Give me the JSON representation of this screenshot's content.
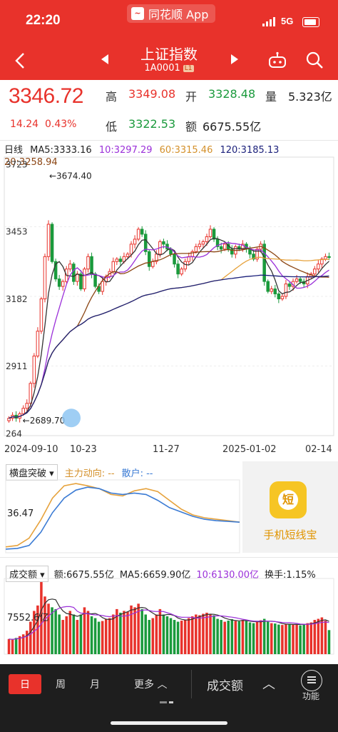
{
  "status": {
    "time": "22:20",
    "app_name": "同花顺 App",
    "network": "5G"
  },
  "header": {
    "title": "上证指数",
    "code": "1A0001",
    "level_tag": "L1"
  },
  "quote": {
    "price": "3346.72",
    "change": "14.24",
    "change_pct": "0.43%",
    "high_label": "高",
    "high": "3349.08",
    "open_label": "开",
    "open": "3328.48",
    "vol_label": "量",
    "volume": "5.323亿",
    "low_label": "低",
    "low": "3322.53",
    "amount_label": "额",
    "amount": "6675.55亿"
  },
  "ma": {
    "period": "日线",
    "ma5": "MA5:3333.16",
    "ma10": "10:3297.29",
    "ma60": "60:3315.46",
    "ma120": "120:3185.13",
    "ma20": "20:3258.94"
  },
  "colors": {
    "brand": "#e8322b",
    "up": "#e8322b",
    "down": "#1a9a3c",
    "ma5": "#333333",
    "ma10": "#9b30d9",
    "ma20": "#8b4513",
    "ma60": "#e6a23c",
    "ma120": "#1a1f7a"
  },
  "chart_data": [
    {
      "type": "candlestick",
      "ylim": [
        2630,
        3750
      ],
      "y_ticks": [
        "3723",
        "3453",
        "3182",
        "2911",
        "264"
      ],
      "x_ticks": [
        "2024-09-10",
        "10-23",
        "11-27",
        "2025-01-02",
        "02-14"
      ],
      "annotations": [
        "←3674.40",
        "←2689.70"
      ],
      "close": [
        2700,
        2712,
        2700,
        2718,
        2740,
        2760,
        2840,
        2950,
        3050,
        3180,
        3350,
        3480,
        3330,
        3260,
        3230,
        3250,
        3300,
        3320,
        3250,
        3280,
        3220,
        3300,
        3350,
        3280,
        3230,
        3210,
        3250,
        3270,
        3290,
        3330,
        3340,
        3330,
        3350,
        3360,
        3400,
        3420,
        3460,
        3440,
        3370,
        3310,
        3330,
        3360,
        3410,
        3400,
        3380,
        3360,
        3320,
        3280,
        3300,
        3330,
        3350,
        3370,
        3390,
        3400,
        3410,
        3430,
        3460,
        3420,
        3390,
        3380,
        3400,
        3380,
        3360,
        3390,
        3380,
        3400,
        3380,
        3360,
        3340,
        3380,
        3400,
        3250,
        3210,
        3220,
        3200,
        3180,
        3190,
        3240,
        3230,
        3250,
        3260,
        3250,
        3240,
        3270,
        3280,
        3300,
        3320,
        3340,
        3350,
        3346.72
      ],
      "volume": [
        4200,
        4000,
        4500,
        5000,
        5500,
        6500,
        9000,
        12000,
        13500,
        20000,
        16000,
        14000,
        13000,
        12500,
        11000,
        9500,
        10500,
        12000,
        11000,
        9500,
        11000,
        13000,
        12000,
        10500,
        10000,
        9000,
        9200,
        9800,
        10000,
        11000,
        12500,
        11500,
        12000,
        11800,
        13500,
        13000,
        14000,
        12500,
        11000,
        9500,
        10000,
        11000,
        12500,
        11000,
        10500,
        10000,
        9500,
        9000,
        9300,
        9600,
        10000,
        10500,
        11000,
        10800,
        11200,
        11500,
        11000,
        10800,
        9800,
        9500,
        9000,
        9300,
        9700,
        9200,
        9100,
        9500,
        9200,
        8800,
        8600,
        9000,
        9400,
        9800,
        9000,
        8600,
        8500,
        8200,
        8100,
        8300,
        8400,
        8200,
        8300,
        8000,
        8400,
        8600,
        8800,
        9500,
        9800,
        10200,
        9300,
        6675
      ]
    },
    {
      "type": "line",
      "ylabel_tick": "36.47",
      "series": [
        {
          "name": "主力动向",
          "values": [
            8,
            10,
            20,
            45,
            75,
            92,
            95,
            92,
            88,
            80,
            78,
            85,
            88,
            84,
            72,
            60,
            52,
            48,
            46,
            44,
            42
          ]
        },
        {
          "name": "散户",
          "values": [
            5,
            6,
            10,
            28,
            55,
            75,
            86,
            90,
            88,
            82,
            80,
            82,
            80,
            72,
            62,
            56,
            50,
            46,
            44,
            43,
            42
          ]
        }
      ]
    }
  ],
  "indicator": {
    "name": "横盘突破",
    "main": "主力动向: --",
    "retail": "散户: --",
    "tick": "36.47",
    "ad_title": "手机短线宝",
    "ad_icon": "短"
  },
  "volume_panel": {
    "name": "成交额",
    "amount": "额:6675.55亿",
    "ma5": "MA5:6659.90亿",
    "ma10": "10:6130.00亿",
    "turnover": "换手:1.15%",
    "tick": "7552.6亿"
  },
  "bottom": {
    "day": "日",
    "week": "周",
    "month": "月",
    "more": "更多",
    "center": "成交额",
    "func": "功能"
  }
}
